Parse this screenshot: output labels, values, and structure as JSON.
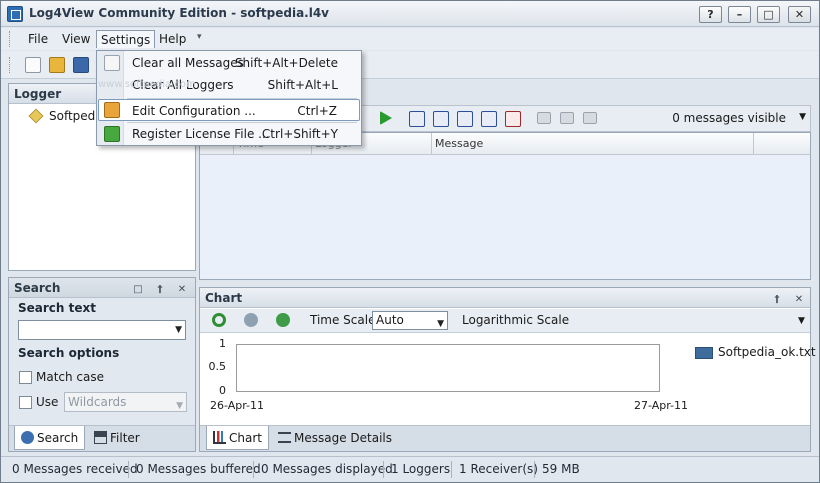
{
  "window": {
    "title": "Log4View Community Edition - softpedia.l4v",
    "help_btn": "?",
    "minimize_btn": "–",
    "maximize_btn": "□",
    "close_btn": "✕"
  },
  "menubar": {
    "file": "File",
    "view": "View",
    "settings": "Settings",
    "help": "Help",
    "overflow": "▾"
  },
  "settings_menu": {
    "items": [
      {
        "label": "Clear all Messages",
        "shortcut": "Shift+Alt+Delete"
      },
      {
        "label": "Clear All Loggers",
        "shortcut": "Shift+Alt+L"
      },
      {
        "label": "Edit Configuration ...",
        "shortcut": "Ctrl+Z"
      },
      {
        "label": "Register License File ...",
        "shortcut": "Ctrl+Shift+Y"
      }
    ]
  },
  "logger_panel": {
    "title": "Logger",
    "tree_item": "Softpedia"
  },
  "search_panel": {
    "title": "Search",
    "pin": "⌂",
    "close": "✕",
    "search_text_label": "Search text",
    "search_text_value": "",
    "search_options_label": "Search options",
    "match_case_label": "Match case",
    "use_label": "Use",
    "use_value": "Wildcards",
    "tabs": [
      {
        "label": "Search"
      },
      {
        "label": "Filter"
      }
    ]
  },
  "message_toolbar": {
    "messages_visible": "0 messages visible"
  },
  "message_grid": {
    "columns": [
      "Time",
      "Logger",
      "Message"
    ]
  },
  "chart_panel": {
    "title": "Chart",
    "time_scale_label": "Time Scale",
    "time_scale_value": "Auto",
    "log_scale_label": "Logarithmic Scale",
    "tabs": [
      {
        "label": "Chart"
      },
      {
        "label": "Message Details"
      }
    ]
  },
  "chart_data": {
    "type": "line",
    "x": [
      "26-Apr-11",
      "27-Apr-11"
    ],
    "series": [
      {
        "name": "Softpedia_ok.txt",
        "values": []
      }
    ],
    "yticks": [
      "1",
      "0.5",
      "0"
    ],
    "ylim": [
      0,
      1
    ],
    "grid": false,
    "legend": "right"
  },
  "status_bar": {
    "items": [
      "0 Messages received",
      "0 Messages buffered",
      "0 Messages displayed",
      "1 Loggers",
      "1 Receiver(s)",
      "59 MB"
    ]
  },
  "watermark": "www.softpedia.com",
  "colors": {
    "accent": "#3e6d9c",
    "window_bg": "#dfe6ee",
    "grid_bg": "#e9f0fa"
  }
}
